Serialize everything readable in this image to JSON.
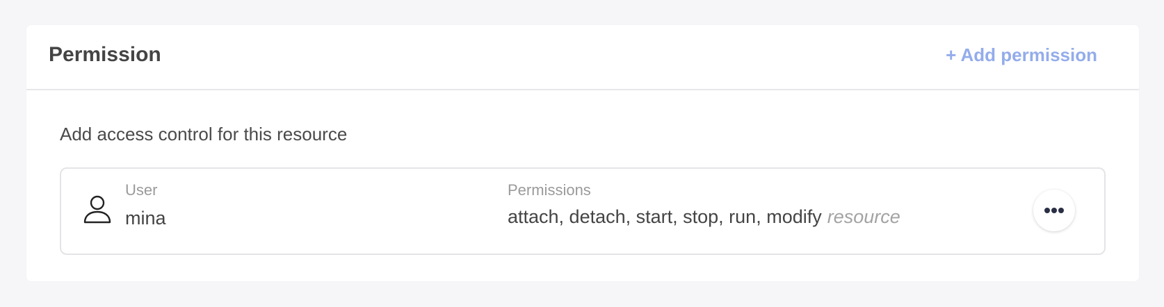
{
  "panel": {
    "title": "Permission",
    "add_button": {
      "icon": "plus-icon",
      "label": "+ Add permission",
      "color": "#93aceb"
    }
  },
  "description": "Add access control for this resource",
  "entries": [
    {
      "icon": "user-icon",
      "type_label": "User",
      "name": "mina",
      "permissions_label": "Permissions",
      "permissions": "attach, detach, start, stop, run, modify",
      "scope": "resource",
      "actions_icon": "more-horizontal-icon"
    }
  ]
}
